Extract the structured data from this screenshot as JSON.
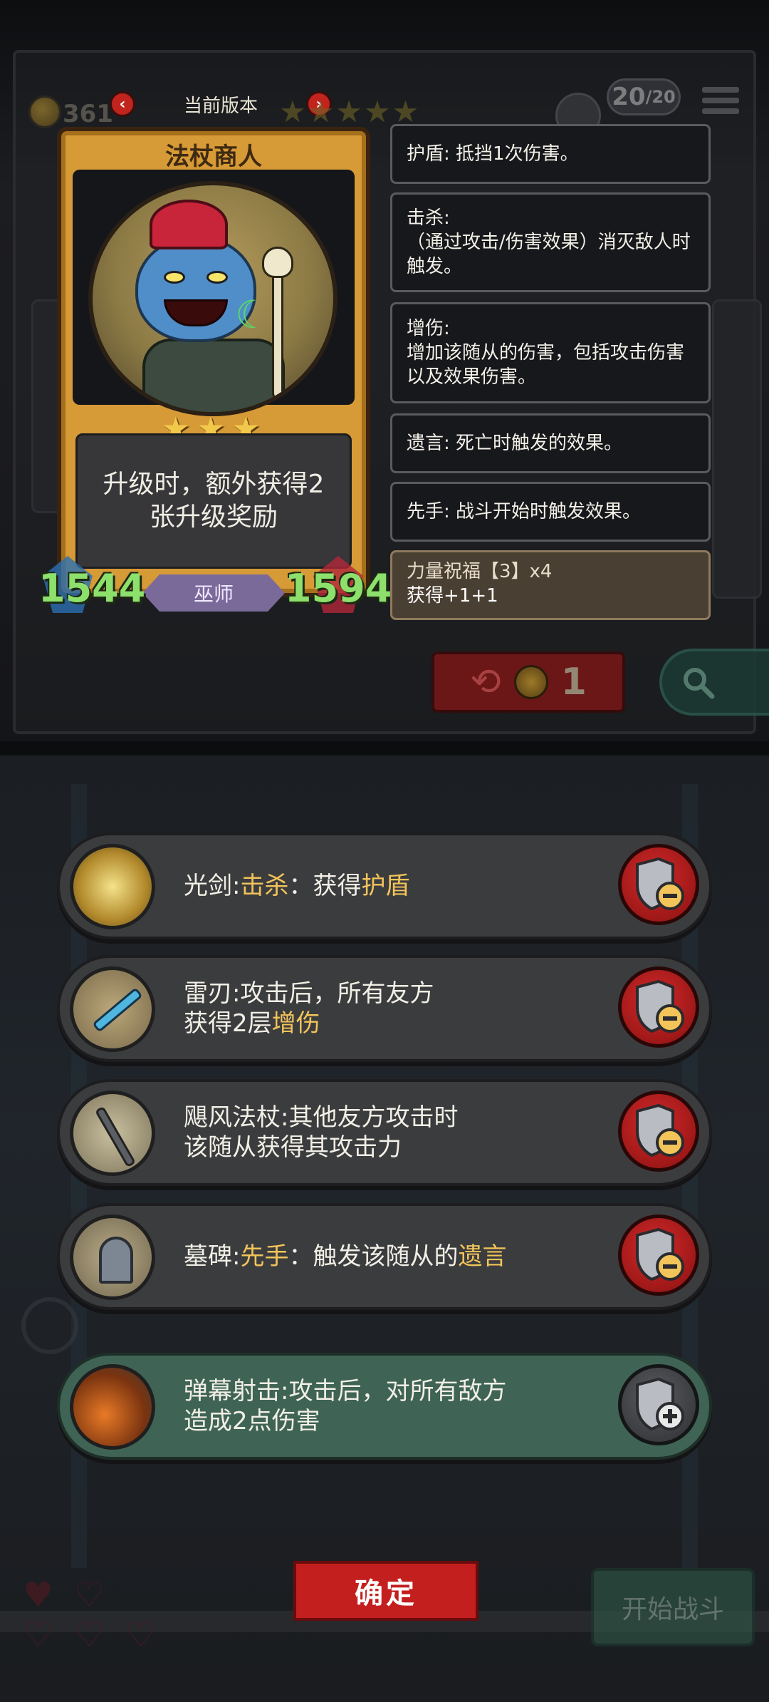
{
  "header": {
    "title": "当前版本",
    "coin_count": "361",
    "round_counter": "20",
    "round_total": "/20",
    "stars": "★★★★★"
  },
  "card": {
    "name": "法杖商人",
    "stars": "★★★",
    "description": "升级时，额外获得2张升级奖励",
    "attack": "1544",
    "health": "1594",
    "tribe": "巫师"
  },
  "keywords": [
    {
      "text": "护盾: 抵挡1次伤害。"
    },
    {
      "text": "击杀:\n（通过攻击/伤害效果）消灭敌人时\n触发。"
    },
    {
      "text": "增伤:\n增加该随从的伤害，包括攻击伤害\n以及效果伤害。"
    },
    {
      "text": "遗言: 死亡时触发的效果。"
    },
    {
      "text": "先手: 战斗开始时触发效果。"
    }
  ],
  "blessing": {
    "title": "力量祝福【3】x4",
    "effect": "获得+1+1"
  },
  "refresh": {
    "cost": "1"
  },
  "equipment": [
    {
      "name": "光剑",
      "parts": [
        [
          "光剑:",
          ""
        ],
        [
          "击杀",
          "kw"
        ],
        [
          "：获得",
          ""
        ],
        [
          "护盾",
          "kw"
        ]
      ],
      "action": "remove"
    },
    {
      "name": "雷刃",
      "lines": [
        "雷刃:攻击后，所有友方",
        [
          "获得2层",
          ""
        ],
        [
          "增伤",
          "kw"
        ]
      ],
      "action": "remove"
    },
    {
      "name": "飓风法杖",
      "lines": [
        "飓风法杖:其他友方攻击时",
        "该随从获得其攻击力"
      ],
      "action": "remove"
    },
    {
      "name": "墓碑",
      "parts": [
        [
          "墓碑:",
          ""
        ],
        [
          "先手",
          "kw"
        ],
        [
          "：触发该随从的",
          ""
        ],
        [
          "遗言",
          "kw"
        ]
      ],
      "action": "remove"
    },
    {
      "name": "弹幕射击",
      "lines": [
        "弹幕射击:攻击后，对所有敌方",
        "造成2点伤害"
      ],
      "action": "add"
    }
  ],
  "buttons": {
    "confirm": "确定",
    "start_battle": "开始战斗"
  },
  "colors": {
    "keyword": "#f2c45a",
    "confirm": "#c41f1f",
    "stat": "#8ee06c"
  }
}
